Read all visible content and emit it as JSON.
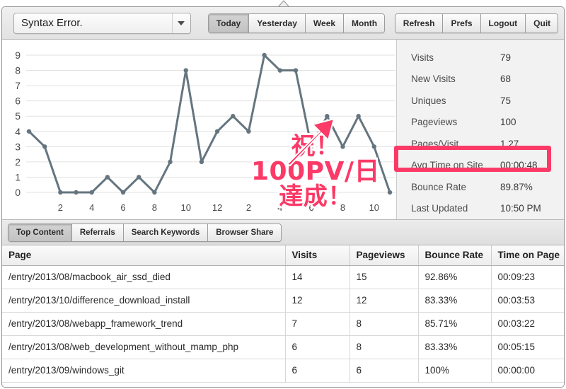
{
  "theme": {
    "accent_pink": "#FB3A67",
    "chart_line": "#65757F",
    "chart_grid": "#E2E2E2"
  },
  "toolbar": {
    "site_selector": {
      "value": "Syntax Error.",
      "chevron_icon": "chevron-down-icon"
    },
    "ranges": [
      {
        "label": "Today",
        "active": true
      },
      {
        "label": "Yesterday",
        "active": false
      },
      {
        "label": "Week",
        "active": false
      },
      {
        "label": "Month",
        "active": false
      }
    ],
    "actions": [
      {
        "label": "Refresh"
      },
      {
        "label": "Prefs"
      },
      {
        "label": "Logout"
      },
      {
        "label": "Quit"
      }
    ]
  },
  "chart_data": {
    "type": "line",
    "title": "",
    "xlabel": "",
    "ylabel": "",
    "grid": true,
    "legend": null,
    "x": [
      0,
      1,
      2,
      3,
      4,
      5,
      6,
      7,
      8,
      9,
      10,
      11,
      12,
      13,
      14,
      15,
      16,
      17,
      18,
      19,
      20,
      21,
      22,
      23
    ],
    "values": [
      4,
      3,
      0,
      0,
      0,
      1,
      0,
      1,
      0,
      2,
      8,
      2,
      4,
      5,
      4,
      9,
      8,
      8,
      3,
      5,
      3,
      5,
      3,
      0
    ],
    "ylim": [
      0,
      9
    ],
    "yticks": [
      0,
      1,
      2,
      3,
      4,
      5,
      6,
      7,
      8,
      9
    ],
    "ytick_labels": [
      "0",
      "1",
      "2",
      "3",
      "4",
      "5",
      "6",
      "7",
      "8",
      "9"
    ],
    "xticks": [
      2,
      4,
      6,
      8,
      10,
      12,
      14,
      16,
      18,
      20,
      22
    ],
    "xtick_labels": [
      "2",
      "4",
      "6",
      "8",
      "10",
      "12",
      "2",
      "4",
      "6",
      "8",
      "10"
    ]
  },
  "stats": {
    "rows": [
      {
        "label": "Visits",
        "value": "79",
        "highlighted": false
      },
      {
        "label": "New Visits",
        "value": "68",
        "highlighted": false
      },
      {
        "label": "Uniques",
        "value": "75",
        "highlighted": false
      },
      {
        "label": "Pageviews",
        "value": "100",
        "highlighted": true
      },
      {
        "label": "Pages/Visit",
        "value": "1.27",
        "highlighted": false
      },
      {
        "label": "Avg Time on Site",
        "value": "00:00:48",
        "highlighted": false
      },
      {
        "label": "Bounce Rate",
        "value": "89.87%",
        "highlighted": false
      },
      {
        "label": "Last Updated",
        "value": "10:50 PM",
        "highlighted": false
      }
    ]
  },
  "tabs": [
    {
      "label": "Top Content",
      "active": true
    },
    {
      "label": "Referrals",
      "active": false
    },
    {
      "label": "Search Keywords",
      "active": false
    },
    {
      "label": "Browser Share",
      "active": false
    }
  ],
  "table": {
    "headers": [
      "Page",
      "Visits",
      "Pageviews",
      "Bounce Rate",
      "Time on Page"
    ],
    "rows": [
      [
        "/entry/2013/08/macbook_air_ssd_died",
        "14",
        "15",
        "92.86%",
        "00:09:23"
      ],
      [
        "/entry/2013/10/difference_download_install",
        "12",
        "12",
        "83.33%",
        "00:03:53"
      ],
      [
        "/entry/2013/08/webapp_framework_trend",
        "7",
        "8",
        "85.71%",
        "00:03:22"
      ],
      [
        "/entry/2013/08/web_development_without_mamp_php",
        "6",
        "8",
        "83.33%",
        "00:05:15"
      ],
      [
        "/entry/2013/09/windows_git",
        "6",
        "6",
        "100%",
        "00:00:00"
      ]
    ]
  },
  "annotation": {
    "line1": "祝！",
    "line2": "100PV/日",
    "line3": "達成！",
    "arrow_icon": "arrow-up-right-icon"
  }
}
